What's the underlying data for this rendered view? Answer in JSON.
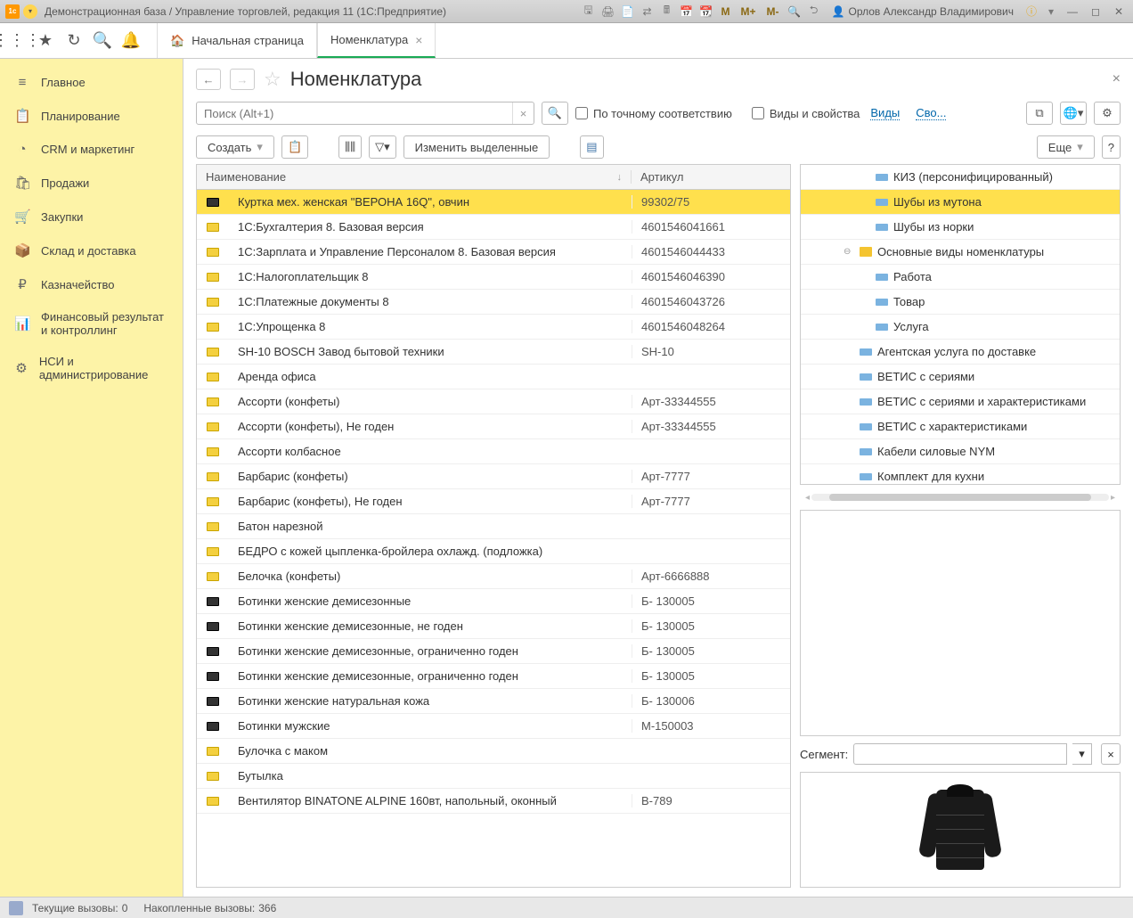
{
  "titlebar": {
    "title": "Демонстрационная база / Управление торговлей, редакция 11 (1С:Предприятие)",
    "user": "Орлов Александр Владимирович",
    "m_buttons": [
      "M",
      "M+",
      "M-"
    ]
  },
  "tabs": {
    "home": "Начальная страница",
    "active": "Номенклатура"
  },
  "nav": [
    {
      "icon": "≡",
      "label": "Главное"
    },
    {
      "icon": "📋",
      "label": "Планирование"
    },
    {
      "icon": "◔",
      "label": "CRM и маркетинг"
    },
    {
      "icon": "🛍",
      "label": "Продажи"
    },
    {
      "icon": "🛒",
      "label": "Закупки"
    },
    {
      "icon": "📦",
      "label": "Склад и доставка"
    },
    {
      "icon": "₽",
      "label": "Казначейство"
    },
    {
      "icon": "📊",
      "label": "Финансовый результат и контроллинг"
    },
    {
      "icon": "⚙",
      "label": "НСИ и администрирование"
    }
  ],
  "page": {
    "title": "Номенклатура"
  },
  "search": {
    "placeholder": "Поиск (Alt+1)"
  },
  "checkboxes": {
    "exact": "По точному соответствию",
    "types": "Виды и свойства"
  },
  "links": {
    "views": "Виды",
    "props": "Сво..."
  },
  "buttons": {
    "create": "Создать",
    "change": "Изменить выделенные",
    "more": "Еще"
  },
  "columns": {
    "name": "Наименование",
    "art": "Артикул"
  },
  "rows": [
    {
      "sel": true,
      "dark": true,
      "name": "Куртка мех. женская \"ВЕРОНА 16Q\", овчин",
      "art": "99302/75"
    },
    {
      "name": "1С:Бухгалтерия 8. Базовая версия",
      "art": "4601546041661"
    },
    {
      "name": "1С:Зарплата и Управление Персоналом 8. Базовая версия",
      "art": "4601546044433"
    },
    {
      "name": "1С:Налогоплательщик 8",
      "art": "4601546046390"
    },
    {
      "name": "1С:Платежные документы 8",
      "art": "4601546043726"
    },
    {
      "name": "1С:Упрощенка 8",
      "art": "4601546048264"
    },
    {
      "name": "SH-10 BOSCH Завод бытовой техники",
      "art": "SH-10"
    },
    {
      "name": "Аренда офиса",
      "art": ""
    },
    {
      "name": "Ассорти (конфеты)",
      "art": "Арт-33344555"
    },
    {
      "name": "Ассорти (конфеты), Не годен",
      "art": "Арт-33344555"
    },
    {
      "name": "Ассорти колбасное",
      "art": ""
    },
    {
      "name": "Барбарис (конфеты)",
      "art": "Арт-7777"
    },
    {
      "name": "Барбарис (конфеты), Не годен",
      "art": "Арт-7777"
    },
    {
      "name": "Батон нарезной",
      "art": ""
    },
    {
      "name": "БЕДРО с кожей цыпленка-бройлера охлажд. (подложка)",
      "art": ""
    },
    {
      "name": "Белочка (конфеты)",
      "art": "Арт-6666888"
    },
    {
      "dark": true,
      "name": "Ботинки женские демисезонные",
      "art": "Б- 130005"
    },
    {
      "dark": true,
      "name": "Ботинки женские демисезонные, не годен",
      "art": "Б- 130005"
    },
    {
      "dark": true,
      "name": "Ботинки женские демисезонные, ограниченно годен",
      "art": "Б- 130005"
    },
    {
      "dark": true,
      "name": "Ботинки женские демисезонные, ограниченно годен",
      "art": "Б- 130005"
    },
    {
      "dark": true,
      "name": "Ботинки женские натуральная кожа",
      "art": "Б- 130006"
    },
    {
      "dark": true,
      "name": "Ботинки мужские",
      "art": "М-150003"
    },
    {
      "name": "Булочка с маком",
      "art": ""
    },
    {
      "name": "Бутылка",
      "art": ""
    },
    {
      "name": "Вентилятор BINATONE ALPINE 160вт, напольный, оконный",
      "art": "В-789"
    }
  ],
  "tree": [
    {
      "indent": 3,
      "label": "КИЗ (персонифицированный)"
    },
    {
      "indent": 3,
      "sel": true,
      "label": "Шубы из мутона"
    },
    {
      "indent": 3,
      "label": "Шубы из норки"
    },
    {
      "indent": 2,
      "folder": true,
      "exp": "⊖",
      "label": "Основные виды номенклатуры"
    },
    {
      "indent": 3,
      "label": "Работа"
    },
    {
      "indent": 3,
      "label": "Товар"
    },
    {
      "indent": 3,
      "label": "Услуга"
    },
    {
      "indent": 2,
      "label": "Агентская услуга по доставке"
    },
    {
      "indent": 2,
      "label": "ВЕТИС с сериями"
    },
    {
      "indent": 2,
      "label": "ВЕТИС с сериями и характеристиками"
    },
    {
      "indent": 2,
      "label": "ВЕТИС с характеристиками"
    },
    {
      "indent": 2,
      "label": "Кабели силовые NYM"
    },
    {
      "indent": 2,
      "label": "Комплект для кухни"
    }
  ],
  "segment": {
    "label": "Сегмент:"
  },
  "status": {
    "current": "Текущие вызовы:",
    "curval": "0",
    "accum": "Накопленные вызовы:",
    "accval": "366"
  }
}
